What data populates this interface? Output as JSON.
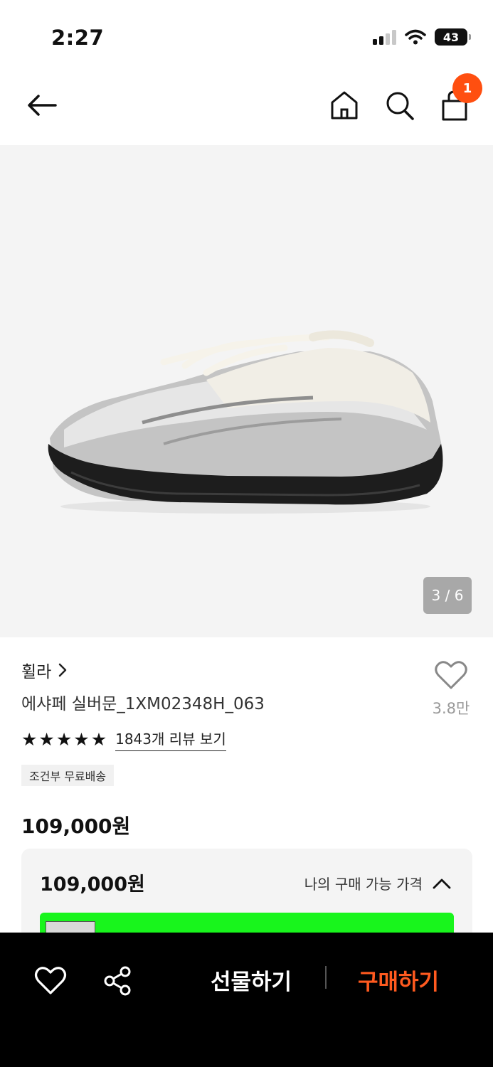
{
  "status_bar": {
    "time": "2:27",
    "battery": "43"
  },
  "header": {
    "cart_count": "1"
  },
  "product_image": {
    "counter": "3 / 6"
  },
  "product": {
    "brand": "휠라",
    "name": "에샤페 실버문_1XM02348H_063",
    "wish_count": "3.8만",
    "rating_stars": 5,
    "review_link": "1843개 리뷰 보기",
    "shipping_tag": "조건부 무료배송",
    "price": "109,000원"
  },
  "price_box": {
    "amount": "109,000원",
    "toggle_label": "나의 구매 가능 가격"
  },
  "bottom_bar": {
    "gift_label": "선물하기",
    "buy_label": "구매하기"
  },
  "colors": {
    "accent": "#ff4f10",
    "buy": "#ff5a1f",
    "promo": "#18f51c"
  },
  "icons": [
    "back-arrow-icon",
    "home-icon",
    "search-icon",
    "shopping-bag-icon",
    "heart-icon",
    "chevron-right-icon",
    "chevron-up-icon",
    "share-icon",
    "star-icon"
  ]
}
